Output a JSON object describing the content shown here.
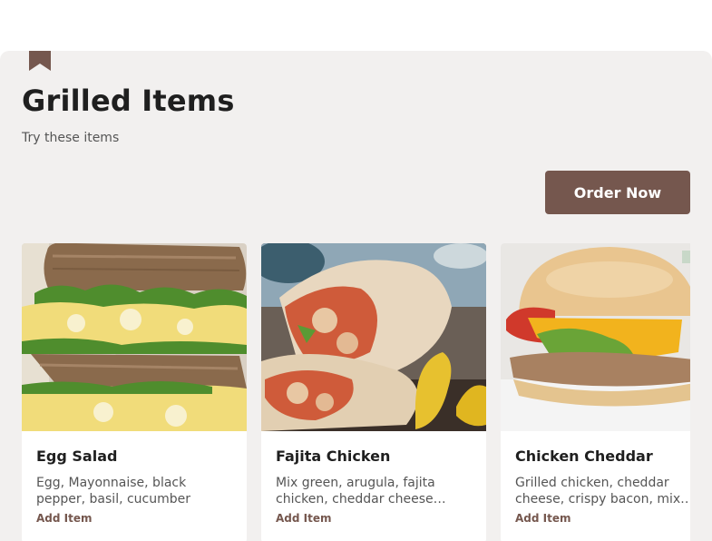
{
  "section": {
    "title": "Grilled Items",
    "subtitle": "Try these items",
    "order_button": "Order Now"
  },
  "icons": {
    "bookmark": "bookmark-icon"
  },
  "colors": {
    "accent": "#75574e",
    "panel": "#f2f0ef"
  },
  "items": [
    {
      "name": "Egg Salad",
      "description": "Egg, Mayonnaise, black pepper, basil, cucumber",
      "action": "Add Item",
      "image": "egg-salad-sandwich-image"
    },
    {
      "name": "Fajita Chicken",
      "description": "Mix green, arugula, fajita chicken, cheddar cheese…",
      "action": "Add Item",
      "image": "fajita-chicken-wrap-image"
    },
    {
      "name": "Chicken Cheddar",
      "description": "Grilled chicken, cheddar cheese, crispy bacon, mix…",
      "action": "Add Item",
      "image": "chicken-cheddar-sandwich-image"
    }
  ]
}
